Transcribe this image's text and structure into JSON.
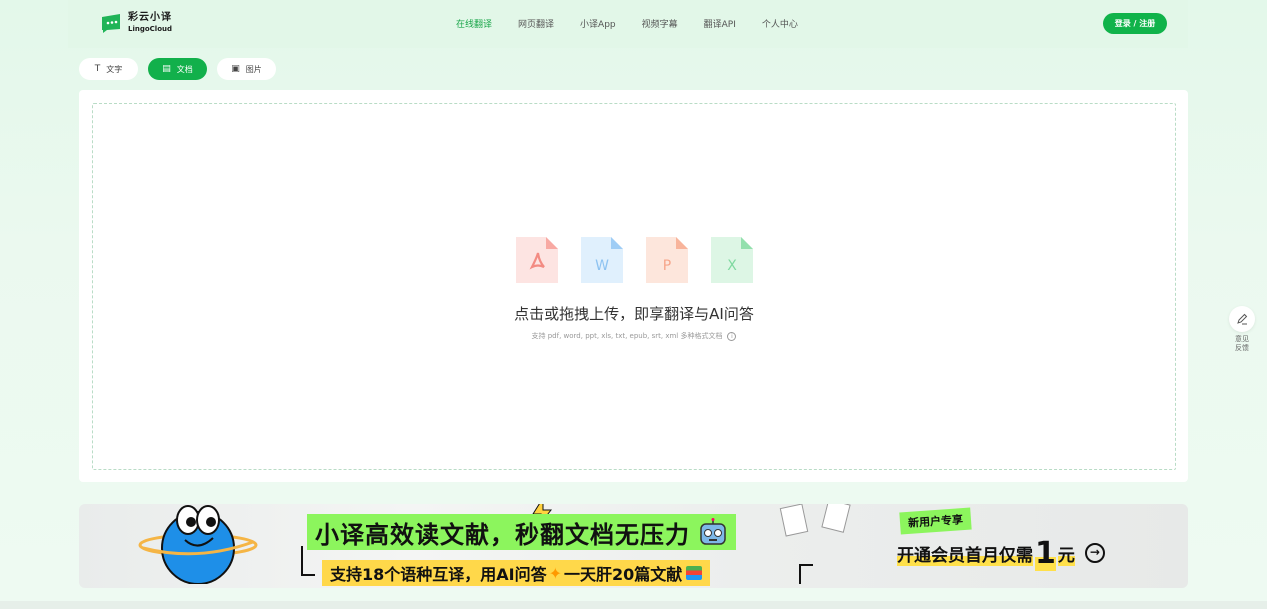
{
  "brand": {
    "name_cn": "彩云小译",
    "name_en": "LingoCloud",
    "accent_color": "#12b04b"
  },
  "nav": {
    "items": [
      {
        "label": "在线翻译",
        "active": true
      },
      {
        "label": "网页翻译",
        "active": false
      },
      {
        "label": "小译App",
        "active": false
      },
      {
        "label": "视频字幕",
        "active": false
      },
      {
        "label": "翻译API",
        "active": false
      },
      {
        "label": "个人中心",
        "active": false
      }
    ],
    "login_label": "登录 / 注册"
  },
  "tabs": [
    {
      "label": "文字",
      "icon": "text-icon",
      "active": false
    },
    {
      "label": "文档",
      "icon": "document-icon",
      "active": true
    },
    {
      "label": "图片",
      "icon": "image-icon",
      "active": false
    }
  ],
  "upload": {
    "file_types": [
      {
        "name": "pdf-icon",
        "color": "#f87171"
      },
      {
        "name": "word-icon",
        "color": "#60a5fa"
      },
      {
        "name": "ppt-icon",
        "color": "#fb923c"
      },
      {
        "name": "excel-icon",
        "color": "#4ade80"
      }
    ],
    "title": "点击或拖拽上传，即享翻译与AI问答",
    "subtitle": "支持 pdf, word, ppt, xls, txt, epub, srt, xml 多种格式文档"
  },
  "banner": {
    "headline": "小译高效读文献，秒翻文档无压力",
    "subline": "支持18个语种互译，用AI问答",
    "subline_tail": "一天肝20篇文献",
    "tag": "新用户专享",
    "promo_prefix": "开通会员首月仅需",
    "promo_number": "1",
    "promo_suffix": "元"
  },
  "feedback": {
    "label": "意见反馈"
  }
}
